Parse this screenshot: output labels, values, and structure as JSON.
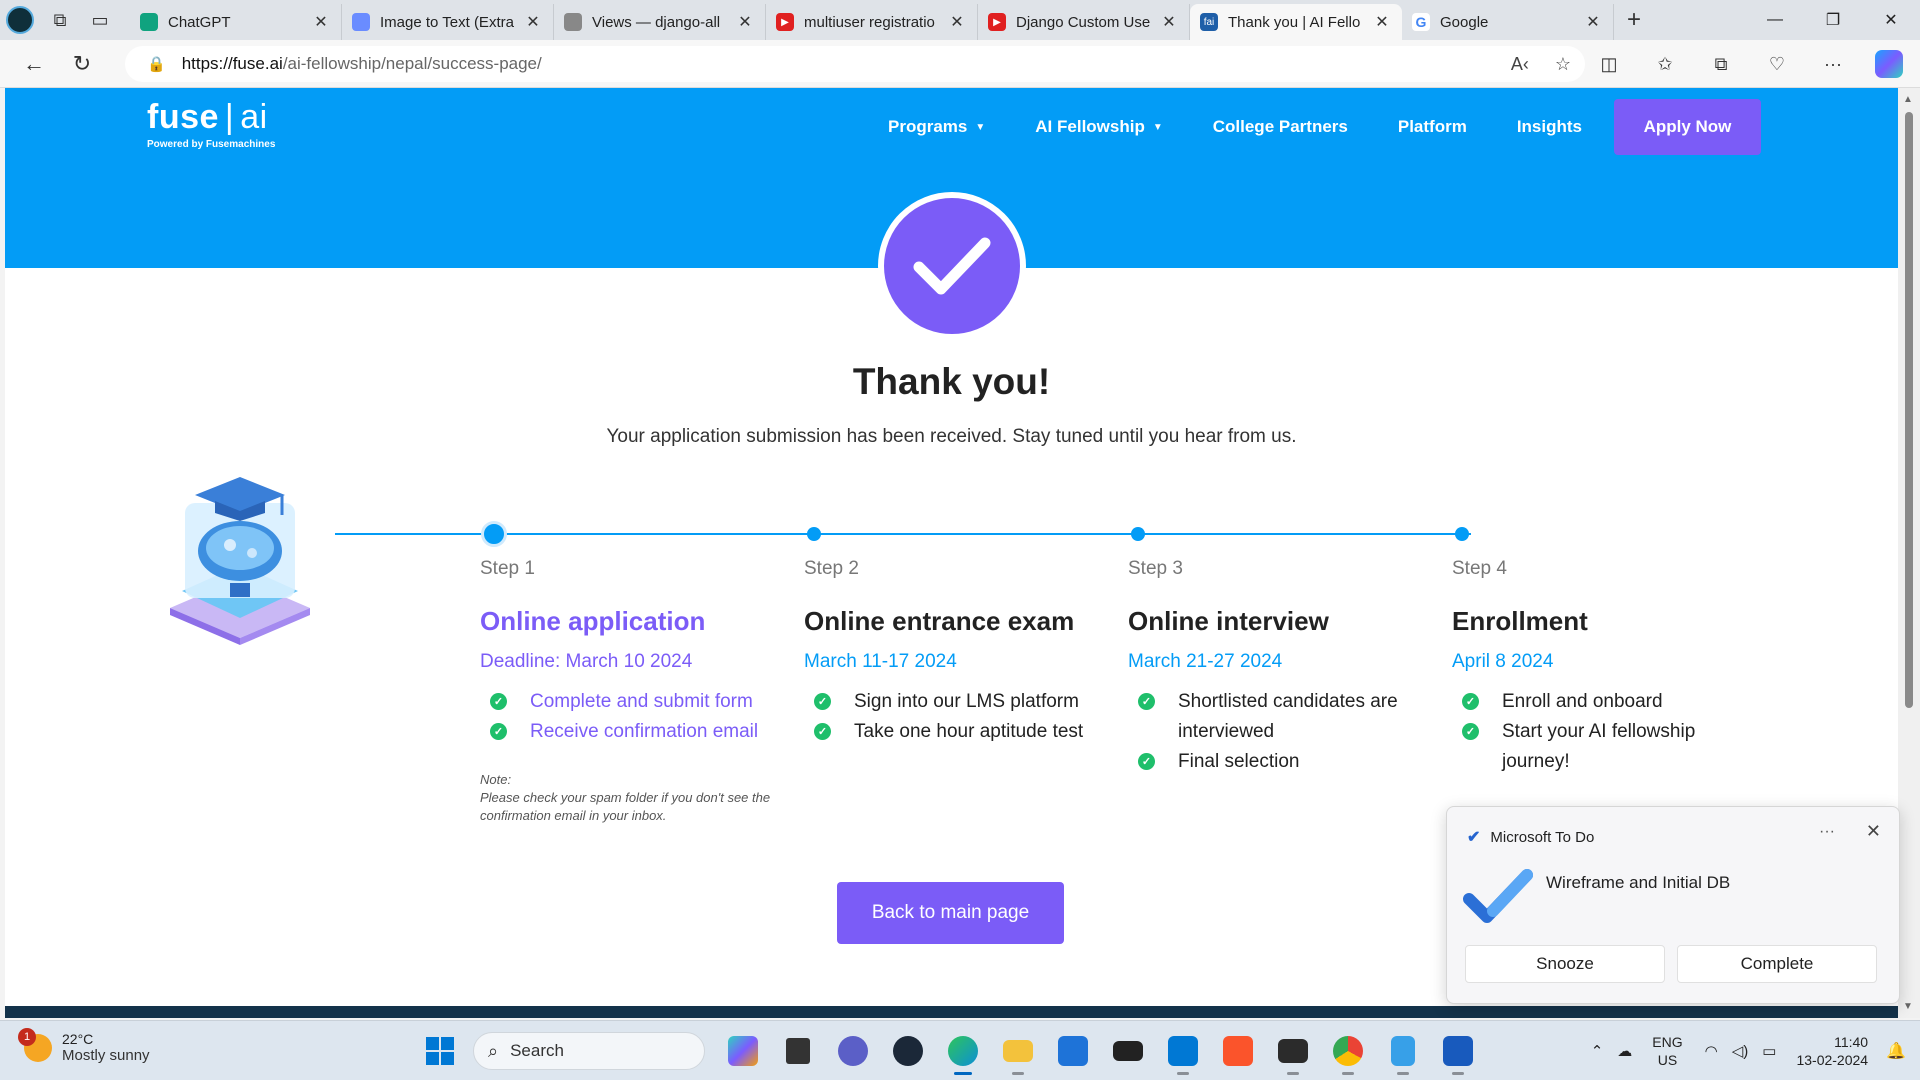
{
  "browser": {
    "tabs": [
      {
        "title": "ChatGPT",
        "favicon_color": "#10a37f"
      },
      {
        "title": "Image to Text (Extra",
        "favicon_color": "#6a8cff"
      },
      {
        "title": "Views — django-all",
        "favicon_color": "#888888"
      },
      {
        "title": "multiuser registratio",
        "favicon_color": "#e02020"
      },
      {
        "title": "Django Custom Use",
        "favicon_color": "#e02020"
      },
      {
        "title": "Thank you | AI Fello",
        "favicon_color": "#1f5fa8",
        "active": true
      },
      {
        "title": "Google",
        "favicon_color": "#4285f4"
      }
    ],
    "new_tab": "+",
    "url_host": "https://fuse.ai",
    "url_path": "/ai-fellowship/nepal/success-page/"
  },
  "site": {
    "logo_main": "fuse",
    "logo_ai": "ai",
    "logo_sub": "Powered by Fusemachines",
    "nav": [
      {
        "label": "Programs",
        "dropdown": true
      },
      {
        "label": "AI Fellowship",
        "dropdown": true
      },
      {
        "label": "College Partners",
        "dropdown": false
      },
      {
        "label": "Platform",
        "dropdown": false
      },
      {
        "label": "Insights",
        "dropdown": false
      }
    ],
    "apply_label": "Apply Now"
  },
  "success": {
    "title": "Thank you!",
    "subtitle": "Your application submission has been received. Stay tuned until you hear from us."
  },
  "steps": [
    {
      "label": "Step 1",
      "heading": "Online application",
      "date": "Deadline: March 10 2024",
      "items": [
        "Complete and submit form",
        "Receive confirmation email"
      ],
      "current": true
    },
    {
      "label": "Step 2",
      "heading": "Online entrance exam",
      "date": "March 11-17 2024",
      "items": [
        "Sign into our LMS platform",
        "Take one hour aptitude test"
      ],
      "current": false
    },
    {
      "label": "Step 3",
      "heading": "Online interview",
      "date": "March 21-27 2024",
      "items": [
        "Shortlisted candidates are interviewed",
        "Final selection"
      ],
      "current": false
    },
    {
      "label": "Step 4",
      "heading": "Enrollment",
      "date": "April 8 2024",
      "items": [
        "Enroll and onboard",
        "Start your AI fellowship journey!"
      ],
      "current": false
    }
  ],
  "note": {
    "title": "Note:",
    "text": "Please check your spam folder if you don't see the confirmation email in your inbox."
  },
  "back_label": "Back to main page",
  "toast": {
    "app": "Microsoft To Do",
    "more": "···",
    "message": "Wireframe and Initial DB",
    "snooze": "Snooze",
    "complete": "Complete"
  },
  "taskbar": {
    "weather_temp": "22°C",
    "weather_desc": "Mostly sunny",
    "weather_badge": "1",
    "search_label": "Search",
    "lang_1": "ENG",
    "lang_2": "US",
    "time": "11:40",
    "date": "13-02-2024",
    "apps": [
      {
        "name": "start",
        "color": "#0078d4"
      },
      {
        "name": "copilot",
        "color": "#7b5cff"
      },
      {
        "name": "file-manager",
        "color": "#333333"
      },
      {
        "name": "chat",
        "color": "#5b5fc7"
      },
      {
        "name": "steam",
        "color": "#1b2838"
      },
      {
        "name": "edge",
        "color": "#0c8fd6"
      },
      {
        "name": "file-explorer",
        "color": "#f3c23c"
      },
      {
        "name": "store",
        "color": "#1e73d8"
      },
      {
        "name": "mysql",
        "color": "#222222"
      },
      {
        "name": "vscode",
        "color": "#0078d4"
      },
      {
        "name": "brave",
        "color": "#fb542b"
      },
      {
        "name": "terminal",
        "color": "#2b2b2b"
      },
      {
        "name": "chrome",
        "color": "#34a853"
      },
      {
        "name": "notepad",
        "color": "#37a0e8"
      },
      {
        "name": "word",
        "color": "#185abd"
      }
    ]
  },
  "colors": {
    "brand_blue": "#039cf6",
    "brand_purple": "#7b5cf7",
    "check_green": "#1fbf6b"
  }
}
